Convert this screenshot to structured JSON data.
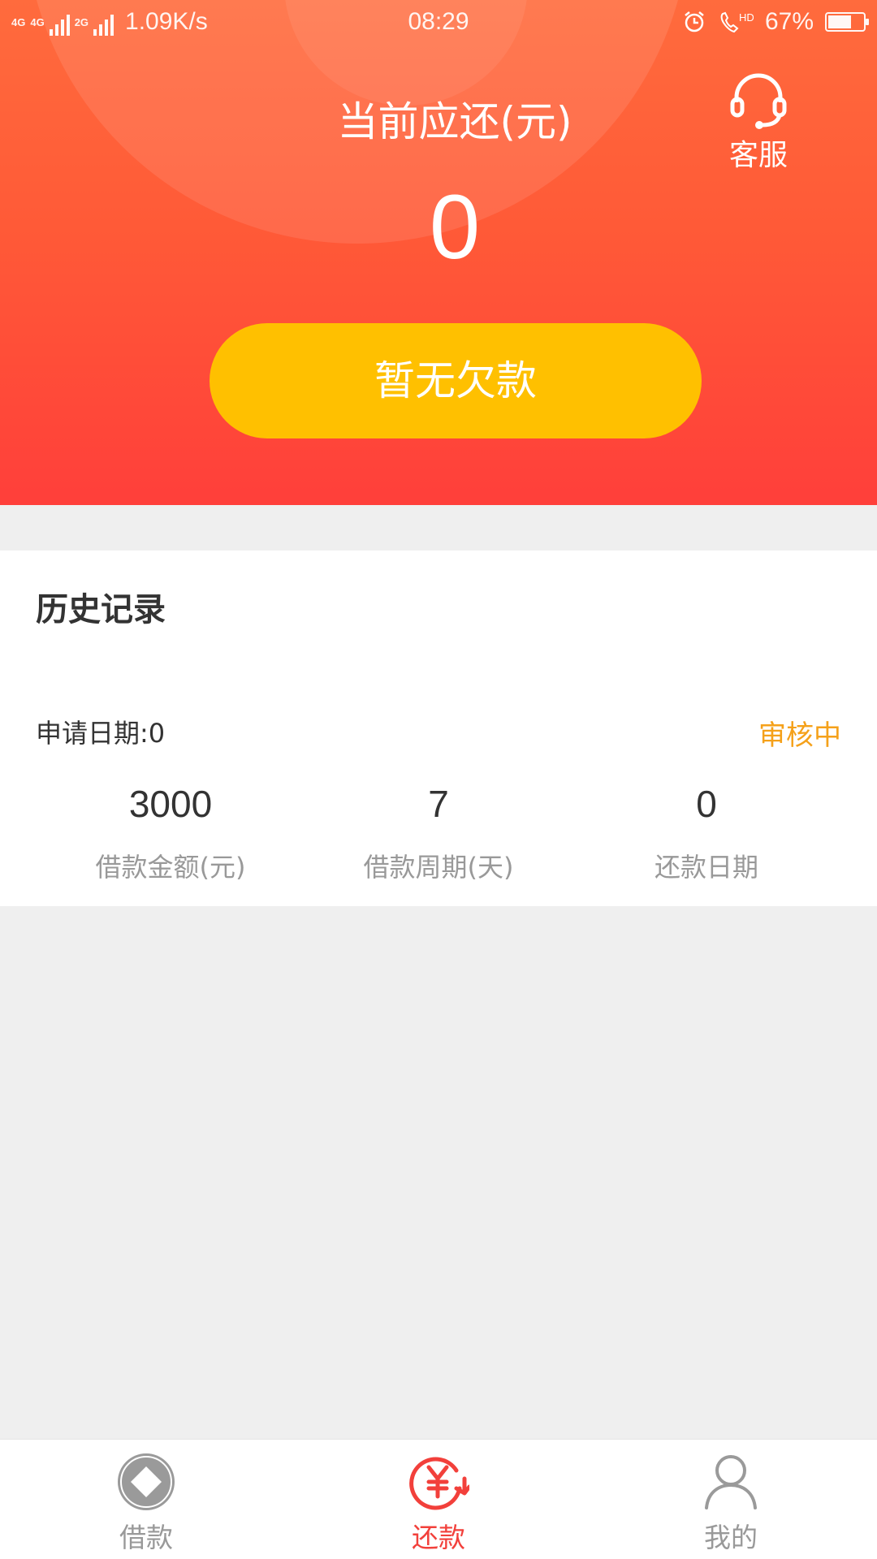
{
  "status_bar": {
    "net_a": "4G",
    "net_b": "4G",
    "net_c": "2G",
    "speed": "1.09K/s",
    "time": "08:29",
    "battery": "67%",
    "battery_level": 0.67
  },
  "header": {
    "due_label": "当前应还(元)",
    "due_amount": "0",
    "customer_service": "客服",
    "debt_button": "暂无欠款"
  },
  "history": {
    "title": "历史记录",
    "apply_date": "申请日期:0",
    "status": "审核中",
    "stats": [
      {
        "value": "3000",
        "label": "借款金额(元)"
      },
      {
        "value": "7",
        "label": "借款周期(天)"
      },
      {
        "value": "0",
        "label": "还款日期"
      }
    ]
  },
  "tabbar": {
    "tabs": [
      {
        "label": "借款",
        "icon": "diamond-coin-icon",
        "active": false
      },
      {
        "label": "还款",
        "icon": "yuan-repay-icon",
        "active": true
      },
      {
        "label": "我的",
        "icon": "user-icon",
        "active": false
      }
    ]
  },
  "colors": {
    "header_top": "#ff6b3d",
    "header_bottom": "#ff3f3a",
    "button": "#ffc000",
    "status_pending": "#f5a11a",
    "tab_active": "#f2403b"
  }
}
